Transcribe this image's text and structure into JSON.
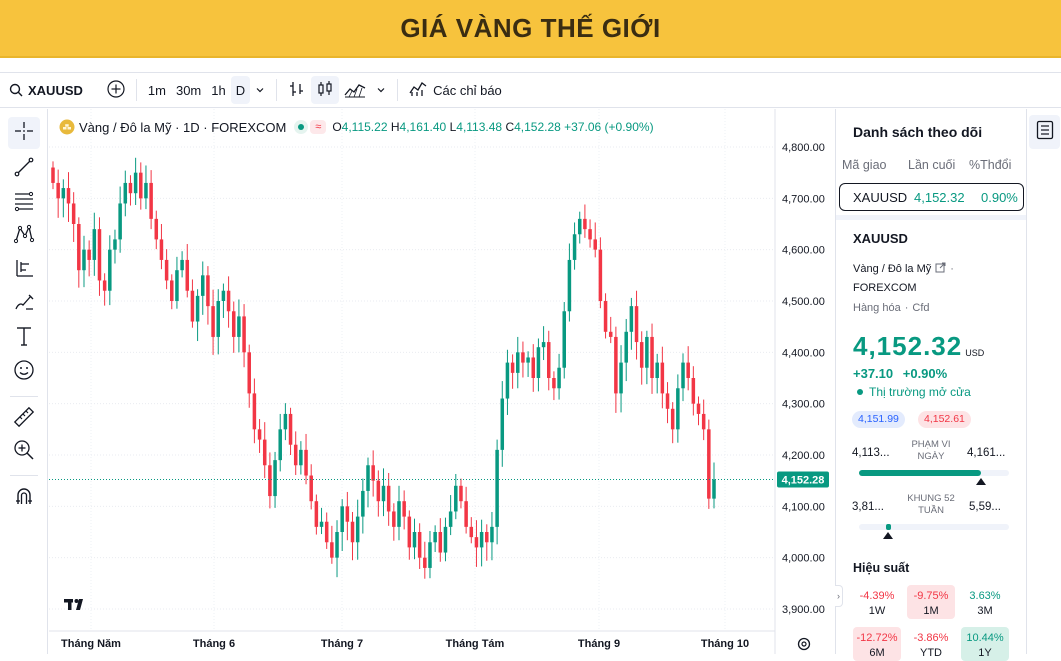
{
  "banner": {
    "title": "GIÁ VÀNG THẾ GIỚI"
  },
  "toolbar": {
    "symbol": "XAUUSD",
    "intervals": [
      "1m",
      "30m",
      "1h",
      "D"
    ],
    "indicators_label": "Các chỉ báo"
  },
  "legend": {
    "name": "Vàng / Đô la Mỹ · 1D · FOREXCOM",
    "o_label": "O",
    "o": "4,115.22",
    "h_label": "H",
    "h": "4,161.40",
    "l_label": "L",
    "l": "4,113.48",
    "c_label": "C",
    "c": "4,152.28",
    "change": "+37.06 (+0.90%)"
  },
  "price_label": "4,152.28",
  "colors": {
    "up": "#089981",
    "down": "#f23645",
    "accent": "#2962ff",
    "banner": "#f7c33d"
  },
  "chart_data": {
    "type": "candlestick",
    "y_ticks": [
      "4,800.00",
      "4,700.00",
      "4,600.00",
      "4,500.00",
      "4,400.00",
      "4,300.00",
      "4,200.00",
      "4,100.00",
      "4,000.00",
      "3,900.00"
    ],
    "x_labels": [
      "Tháng Năm",
      "Tháng 6",
      "Tháng 7",
      "Tháng Tám",
      "Tháng 9",
      "Tháng 10"
    ],
    "ylim": [
      3880,
      4840
    ],
    "last_price": 4152.28,
    "grid": true,
    "closes": [
      4730,
      4700,
      4720,
      4690,
      4650,
      4560,
      4600,
      4580,
      4640,
      4540,
      4520,
      4600,
      4620,
      4690,
      4730,
      4710,
      4750,
      4700,
      4730,
      4660,
      4620,
      4580,
      4540,
      4500,
      4560,
      4580,
      4520,
      4460,
      4510,
      4550,
      4490,
      4430,
      4500,
      4520,
      4480,
      4430,
      4470,
      4400,
      4320,
      4250,
      4230,
      4180,
      4120,
      4190,
      4250,
      4280,
      4220,
      4180,
      4210,
      4160,
      4110,
      4060,
      4070,
      4030,
      4000,
      4050,
      4100,
      4070,
      4030,
      4080,
      4130,
      4180,
      4150,
      4110,
      4140,
      4090,
      4060,
      4110,
      4080,
      4020,
      4050,
      4000,
      3980,
      4030,
      4050,
      4010,
      4060,
      4090,
      4140,
      4110,
      4060,
      4040,
      4020,
      4050,
      4030,
      4060,
      4210,
      4310,
      4380,
      4360,
      4400,
      4380,
      4390,
      4350,
      4410,
      4420,
      4350,
      4330,
      4370,
      4480,
      4580,
      4630,
      4660,
      4640,
      4620,
      4600,
      4500,
      4440,
      4430,
      4320,
      4380,
      4440,
      4490,
      4420,
      4370,
      4430,
      4350,
      4380,
      4320,
      4290,
      4250,
      4330,
      4380,
      4350,
      4300,
      4280,
      4250,
      4115,
      4152.28
    ],
    "volumes": []
  },
  "watchlist": {
    "title": "Danh sách theo dõi",
    "col_symbol": "Mã giao",
    "col_last": "Lần cuối",
    "col_change": "%Thđổi",
    "row": {
      "symbol": "XAUUSD",
      "last": "4,152.32",
      "change": "0.90%"
    }
  },
  "details": {
    "symbol": "XAUUSD",
    "name": "Vàng / Đô la Mỹ",
    "exchange": "FOREXCOM",
    "category": "Hàng hóa",
    "type": "Cfd",
    "price": "4,152.32",
    "currency": "USD",
    "change": "+37.10",
    "change_pct": "+0.90%",
    "market_status": "Thị trường mở cửa",
    "bid": "4,151.99",
    "ask": "4,152.61",
    "day_low": "4,113...",
    "day_high": "4,161...",
    "day_range_label_1": "PHẠM VI",
    "day_range_label_2": "NGÀY",
    "w52_low": "3,81...",
    "w52_high": "5,59...",
    "w52_label_1": "KHUNG 52",
    "w52_label_2": "TUẦN",
    "performance_title": "Hiệu suất",
    "performance": [
      {
        "value": "-4.39%",
        "label": "1W"
      },
      {
        "value": "-9.75%",
        "label": "1M"
      },
      {
        "value": "3.63%",
        "label": "3M"
      },
      {
        "value": "-12.72%",
        "label": "6M"
      },
      {
        "value": "-3.86%",
        "label": "YTD"
      },
      {
        "value": "10.44%",
        "label": "1Y"
      }
    ]
  }
}
